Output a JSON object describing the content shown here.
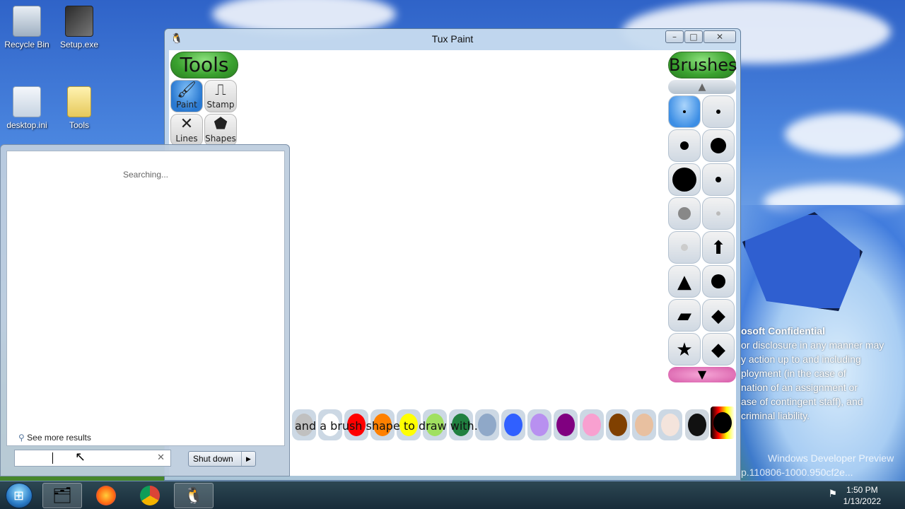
{
  "desktop": {
    "icons": [
      {
        "label": "Recycle Bin",
        "icon": "recycle-bin-icon"
      },
      {
        "label": "Setup.exe",
        "icon": "installer-icon"
      },
      {
        "label": "desktop.ini",
        "icon": "settings-file-icon"
      },
      {
        "label": "Tools",
        "icon": "folder-icon"
      }
    ],
    "watermark": {
      "title": "osoft Confidential",
      "lines": [
        "or disclosure in any manner may",
        "y action up to and including",
        "ployment (in the case of",
        "nation of an assignment or",
        "ase of contingent staff), and",
        "criminal liability."
      ]
    },
    "build": [
      "Windows Developer Preview",
      "p.110806-1000.950cf2e..."
    ]
  },
  "window": {
    "title": "Tux Paint",
    "tools_header": "Tools",
    "brushes_header": "Brushes",
    "tools": [
      {
        "label": "Paint",
        "icon": "paintbrush-icon",
        "selected": true
      },
      {
        "label": "Stamp",
        "icon": "stamp-icon",
        "selected": false
      },
      {
        "label": "Lines",
        "icon": "lines-icon",
        "selected": false
      },
      {
        "label": "Shapes",
        "icon": "pentagon-icon",
        "selected": false
      }
    ],
    "colors": [
      "#c0c0c0",
      "#ffffff",
      "#ff0000",
      "#ff8000",
      "#ffff00",
      "#a0e060",
      "#208040",
      "#8fa8c8",
      "#3060ff",
      "#b890f0",
      "#800080",
      "#f8a0d0",
      "#804000",
      "#e8c0a0",
      "#f4e4dc"
    ],
    "status": "and a brush shape to draw with."
  },
  "startmenu": {
    "searching": "Searching...",
    "see_more": "See more results",
    "search_value": "",
    "shutdown": "Shut down"
  },
  "taskbar": {
    "time": "1:50 PM",
    "date": "1/13/2022"
  }
}
